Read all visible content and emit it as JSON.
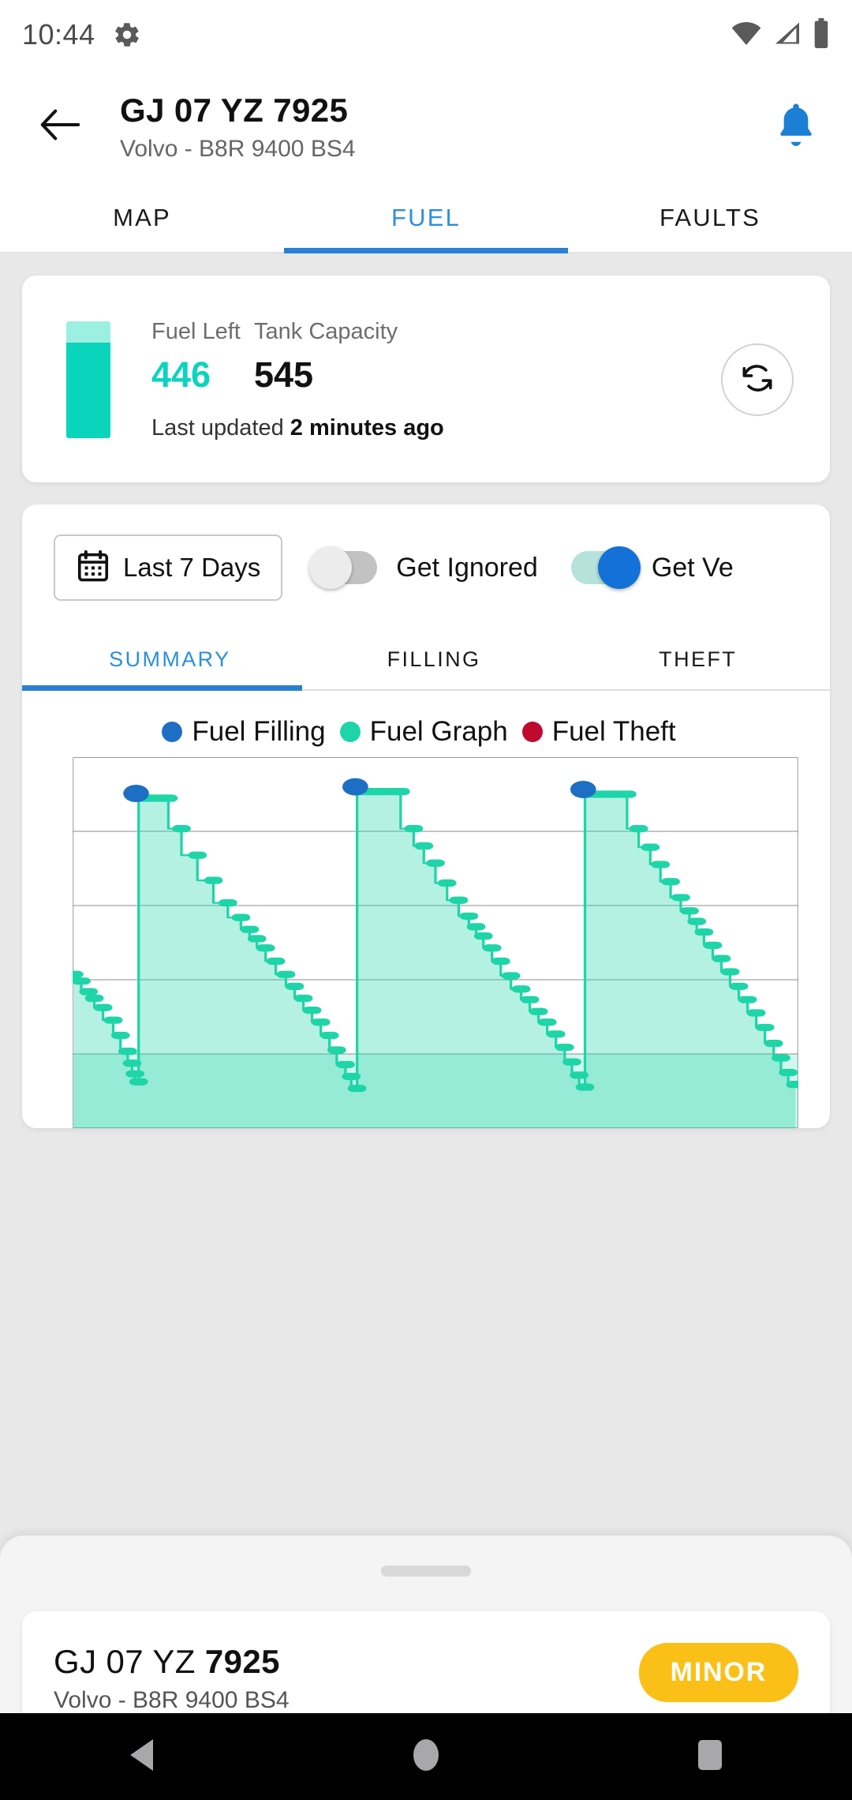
{
  "statusbar": {
    "time": "10:44",
    "icons": [
      "gear-icon",
      "wifi-icon",
      "signal-icon",
      "battery-icon"
    ]
  },
  "header": {
    "back_icon": "arrow-left-icon",
    "title": "GJ 07 YZ 7925",
    "subtitle": "Volvo - B8R 9400 BS4",
    "notification_icon": "bell-icon"
  },
  "main_tabs": [
    {
      "label": "MAP",
      "active": false
    },
    {
      "label": "FUEL",
      "active": true
    },
    {
      "label": "FAULTS",
      "active": false
    }
  ],
  "fuel_card": {
    "gauge_icon": "fuel-tank-gauge",
    "fuel_left_label": "Fuel Left",
    "fuel_left_value": "446",
    "tank_capacity_label": "Tank Capacity",
    "tank_capacity_value": "545",
    "last_updated_prefix": "Last updated ",
    "last_updated_value": "2 minutes ago",
    "refresh_icon": "refresh-sync-icon"
  },
  "controls": {
    "date_range_icon": "calendar-icon",
    "date_range_label": "Last 7 Days",
    "toggle_ignored_label": "Get Ignored",
    "toggle_ignored_on": false,
    "toggle_verified_label": "Get Ve",
    "toggle_verified_on": true
  },
  "sub_tabs": [
    {
      "label": "SUMMARY",
      "active": true
    },
    {
      "label": "FILLING",
      "active": false
    },
    {
      "label": "THEFT",
      "active": false
    }
  ],
  "colors": {
    "accent_blue": "#2a7fd4",
    "fuel_teal": "#0bd4bd",
    "fuel_fill": "#a9eddf",
    "filling_blue": "#1d6fc4",
    "theft_red": "#bf0a30",
    "badge_yellow": "#fbc017"
  },
  "bottom_sheet": {
    "handle": "drag-handle",
    "plate_prefix": "GJ 07 YZ ",
    "plate_number": "7925",
    "subtitle": "Volvo - B8R 9400 BS4",
    "badge_label": "MINOR"
  },
  "navbar": {
    "back": "triangle-back-icon",
    "home": "circle-home-icon",
    "recents": "square-recents-icon"
  },
  "chart_data": {
    "type": "line",
    "title": "",
    "xlabel": "",
    "ylabel": "",
    "grid": true,
    "legend_position": "top-center",
    "ylim": [
      0,
      560
    ],
    "xlim": [
      0,
      100
    ],
    "gridlines_y": [
      112,
      224,
      336,
      448
    ],
    "series": [
      {
        "name": "Fuel Filling",
        "color": "#1d6fc4",
        "marker": "circle"
      },
      {
        "name": "Fuel Graph",
        "color": "#1ed5a8",
        "marker": "circle"
      },
      {
        "name": "Fuel Theft",
        "color": "#bf0a30",
        "marker": "circle"
      }
    ],
    "fuel_level_points": [
      [
        0.2,
        232
      ],
      [
        1.2,
        222
      ],
      [
        2.2,
        206
      ],
      [
        3.0,
        196
      ],
      [
        4.2,
        182
      ],
      [
        5.6,
        163
      ],
      [
        6.6,
        140
      ],
      [
        7.6,
        116
      ],
      [
        8.2,
        98
      ],
      [
        8.6,
        82
      ],
      [
        9.1,
        70
      ],
      [
        9.4,
        498
      ],
      [
        10.4,
        498
      ],
      [
        11.0,
        498
      ],
      [
        12.4,
        498
      ],
      [
        13.2,
        498
      ],
      [
        15.0,
        452
      ],
      [
        17.2,
        412
      ],
      [
        19.4,
        374
      ],
      [
        21.4,
        340
      ],
      [
        23.2,
        318
      ],
      [
        24.4,
        300
      ],
      [
        25.4,
        286
      ],
      [
        26.6,
        272
      ],
      [
        28.0,
        252
      ],
      [
        29.4,
        232
      ],
      [
        30.6,
        214
      ],
      [
        31.8,
        196
      ],
      [
        33.0,
        178
      ],
      [
        34.2,
        160
      ],
      [
        35.4,
        140
      ],
      [
        36.4,
        118
      ],
      [
        37.6,
        96
      ],
      [
        38.4,
        78
      ],
      [
        39.2,
        60
      ],
      [
        39.6,
        508
      ],
      [
        41.0,
        508
      ],
      [
        42.4,
        508
      ],
      [
        43.8,
        508
      ],
      [
        45.2,
        508
      ],
      [
        47.0,
        452
      ],
      [
        48.4,
        426
      ],
      [
        50.0,
        400
      ],
      [
        51.6,
        370
      ],
      [
        53.2,
        344
      ],
      [
        54.6,
        320
      ],
      [
        55.6,
        304
      ],
      [
        56.6,
        290
      ],
      [
        57.8,
        272
      ],
      [
        59.0,
        252
      ],
      [
        60.4,
        230
      ],
      [
        61.8,
        210
      ],
      [
        63.0,
        194
      ],
      [
        64.2,
        176
      ],
      [
        65.4,
        160
      ],
      [
        66.6,
        142
      ],
      [
        67.8,
        122
      ],
      [
        68.8,
        100
      ],
      [
        69.8,
        80
      ],
      [
        70.6,
        62
      ],
      [
        71.0,
        504
      ],
      [
        72.4,
        504
      ],
      [
        73.8,
        504
      ],
      [
        75.0,
        504
      ],
      [
        76.4,
        504
      ],
      [
        78.0,
        452
      ],
      [
        79.6,
        424
      ],
      [
        81.0,
        398
      ],
      [
        82.4,
        372
      ],
      [
        83.8,
        348
      ],
      [
        85.0,
        328
      ],
      [
        86.0,
        312
      ],
      [
        87.0,
        296
      ],
      [
        88.2,
        276
      ],
      [
        89.4,
        256
      ],
      [
        90.6,
        236
      ],
      [
        91.8,
        214
      ],
      [
        93.0,
        194
      ],
      [
        94.2,
        174
      ],
      [
        95.4,
        152
      ],
      [
        96.6,
        128
      ],
      [
        97.6,
        106
      ],
      [
        98.6,
        84
      ],
      [
        99.6,
        66
      ]
    ],
    "filling_events": [
      {
        "x": 9.4,
        "y": 498
      },
      {
        "x": 39.6,
        "y": 508
      },
      {
        "x": 71.0,
        "y": 504
      }
    ],
    "theft_events": []
  }
}
